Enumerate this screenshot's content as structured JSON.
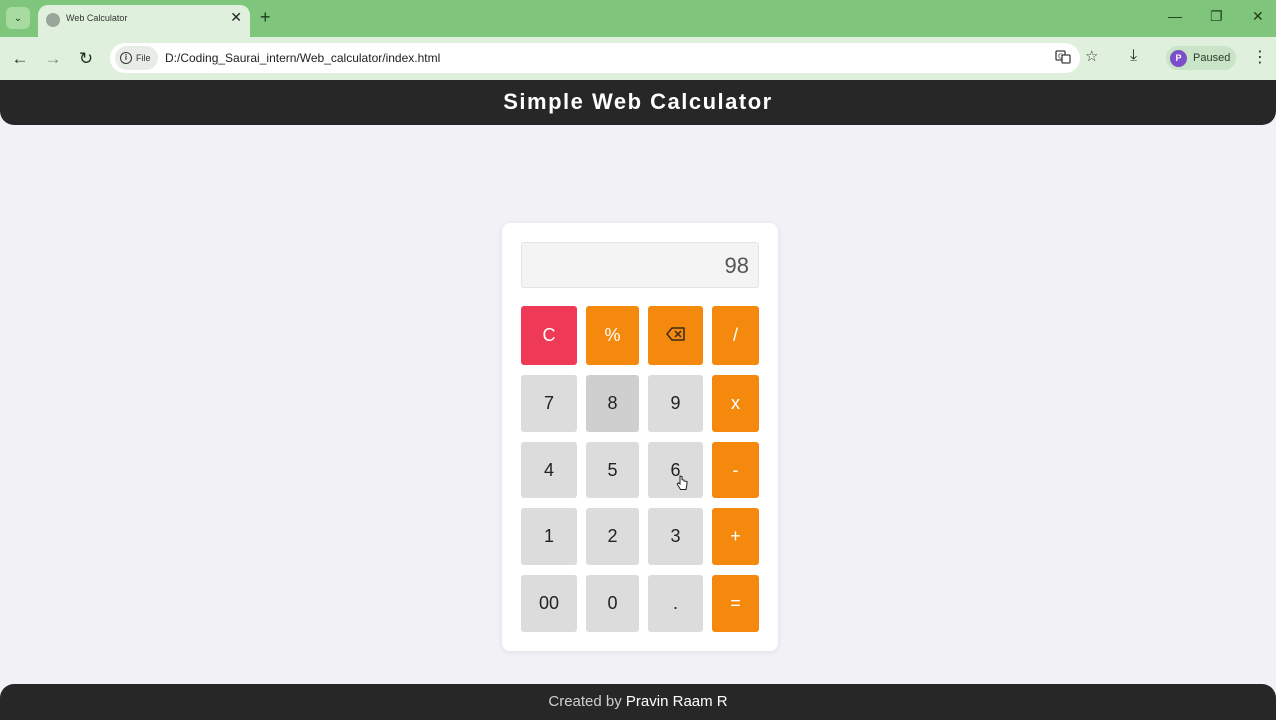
{
  "browser": {
    "tab_title": "Web Calculator",
    "tab_close": "✕",
    "new_tab": "+",
    "chip_label": "File",
    "url": "D:/Coding_Saurai_intern/Web_calculator/index.html",
    "profile_initial": "P",
    "profile_status": "Paused",
    "window_controls": {
      "minimize": "—",
      "restore": "❐",
      "close": "✕"
    }
  },
  "page": {
    "title": "Simple Web Calculator",
    "display_value": "98",
    "keys": {
      "clear": "C",
      "percent": "%",
      "divide": "/",
      "seven": "7",
      "eight": "8",
      "nine": "9",
      "multiply": "x",
      "four": "4",
      "five": "5",
      "six": "6",
      "minus": "-",
      "one": "1",
      "two": "2",
      "three": "3",
      "plus": "+",
      "double_zero": "00",
      "zero": "0",
      "dot": ".",
      "equals": "="
    },
    "footer": {
      "prefix": "Created by ",
      "author": "Pravin Raam R"
    }
  },
  "colors": {
    "operator": "#f5890e",
    "clear": "#ee3a57",
    "number": "#dcdcdc",
    "header": "#272727",
    "browser_frame": "#7fc67c"
  },
  "icons": [
    "tab-search-icon",
    "favicon-icon",
    "back-icon",
    "forward-icon",
    "reload-icon",
    "info-icon",
    "translate-icon",
    "star-icon",
    "download-icon",
    "menu-icon",
    "backspace-icon",
    "cursor-icon"
  ]
}
